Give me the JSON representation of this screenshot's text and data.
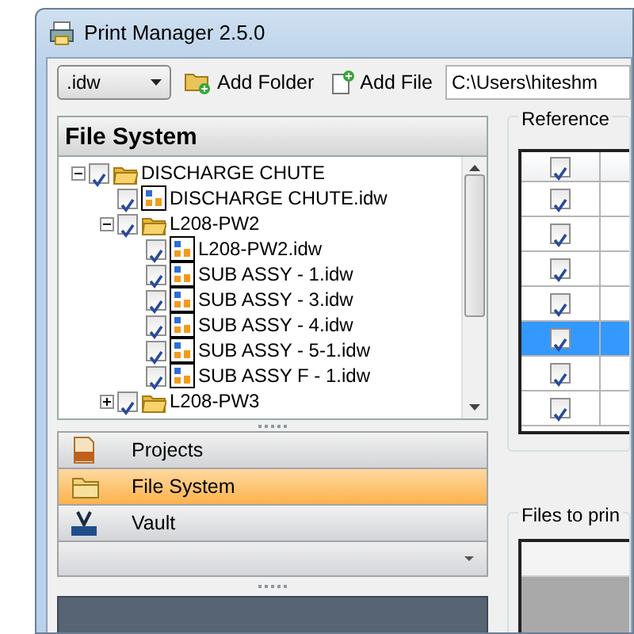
{
  "window": {
    "title": "Print Manager 2.5.0"
  },
  "toolbar": {
    "filter": {
      "value": ".idw"
    },
    "buttons": [
      {
        "label": "Add Folder",
        "kind": "folder"
      },
      {
        "label": "Add File",
        "kind": "file"
      }
    ],
    "path": {
      "value": "C:\\Users\\hiteshm"
    }
  },
  "file_system": {
    "title": "File System",
    "tree": [
      {
        "label": "DISCHARGE CHUTE",
        "kind": "folder",
        "checked": true,
        "expanded": true,
        "children": [
          {
            "label": "DISCHARGE CHUTE.idw",
            "kind": "drawing",
            "checked": true
          },
          {
            "label": "L208-PW2",
            "kind": "folder",
            "checked": true,
            "expanded": true,
            "children": [
              {
                "label": "L208-PW2.idw",
                "kind": "drawing",
                "checked": true
              },
              {
                "label": "SUB ASSY - 1.idw",
                "kind": "drawing",
                "checked": true
              },
              {
                "label": "SUB ASSY - 3.idw",
                "kind": "drawing",
                "checked": true
              },
              {
                "label": "SUB ASSY - 4.idw",
                "kind": "drawing",
                "checked": true
              },
              {
                "label": "SUB ASSY - 5-1.idw",
                "kind": "drawing",
                "checked": true
              },
              {
                "label": "SUB ASSY F - 1.idw",
                "kind": "drawing",
                "checked": true
              }
            ]
          },
          {
            "label": "L208-PW3",
            "kind": "folder",
            "checked": true,
            "expanded": false
          }
        ]
      }
    ]
  },
  "navigation": [
    {
      "label": "Projects",
      "kind": "projects",
      "selected": false
    },
    {
      "label": "File System",
      "kind": "folder",
      "selected": true
    },
    {
      "label": "Vault",
      "kind": "vault",
      "selected": false
    }
  ],
  "reference": {
    "title": "Reference",
    "header_checked": true,
    "rows": [
      {
        "checked": true,
        "selected": false
      },
      {
        "checked": true,
        "selected": false
      },
      {
        "checked": true,
        "selected": false
      },
      {
        "checked": true,
        "selected": false
      },
      {
        "checked": true,
        "selected": true
      },
      {
        "checked": true,
        "selected": false
      },
      {
        "checked": true,
        "selected": false
      }
    ]
  },
  "files_to_print": {
    "title": "Files to prin"
  }
}
